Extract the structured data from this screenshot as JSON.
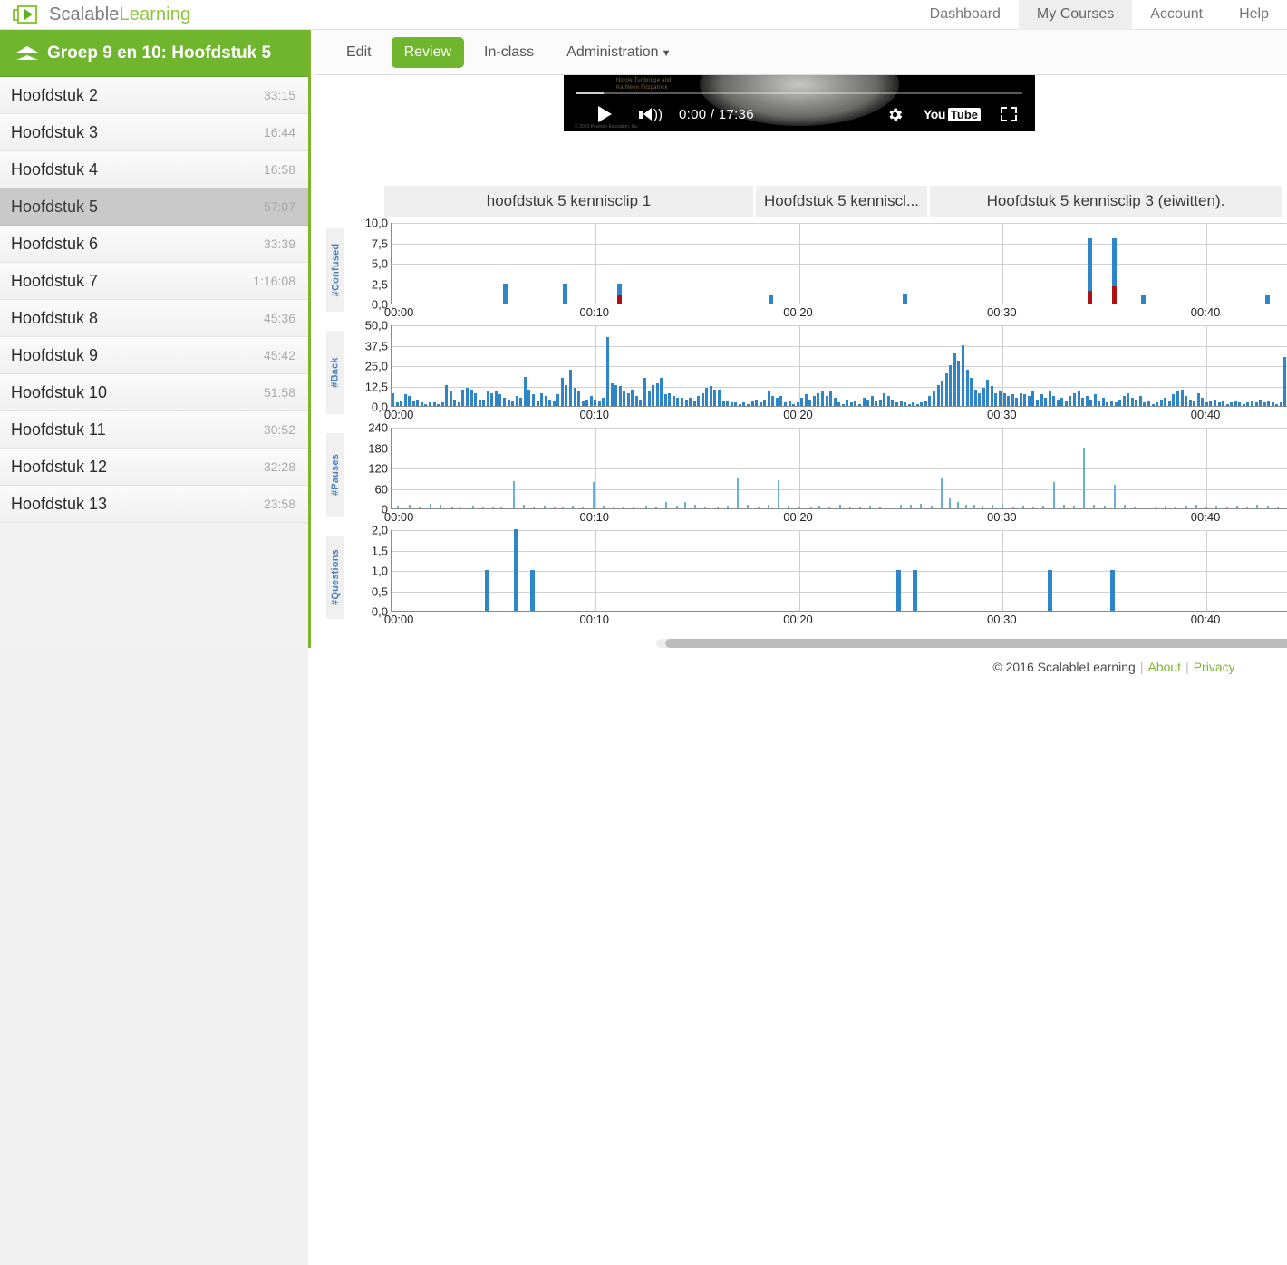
{
  "brand": {
    "name_part1": "Scalable",
    "name_part2": "Learning",
    "logo_icon": "speaker-play-icon",
    "green": "#8dc63f"
  },
  "topnav": {
    "items": [
      {
        "label": "Dashboard",
        "active": false
      },
      {
        "label": "My Courses",
        "active": true
      },
      {
        "label": "Account",
        "active": false
      },
      {
        "label": "Help",
        "active": false
      }
    ]
  },
  "sidebar": {
    "header": {
      "title": "Groep 9 en 10: Hoofdstuk 5",
      "icon": "chevron-up-icon"
    },
    "items": [
      {
        "label": "Hoofdstuk 2",
        "time": "33:15",
        "selected": false
      },
      {
        "label": "Hoofdstuk 3",
        "time": "16:44",
        "selected": false
      },
      {
        "label": "Hoofdstuk 4",
        "time": "16:58",
        "selected": false
      },
      {
        "label": "Hoofdstuk 5",
        "time": "57:07",
        "selected": true
      },
      {
        "label": "Hoofdstuk 6",
        "time": "33:39",
        "selected": false
      },
      {
        "label": "Hoofdstuk 7",
        "time": "1:16:08",
        "selected": false
      },
      {
        "label": "Hoofdstuk 8",
        "time": "45:36",
        "selected": false
      },
      {
        "label": "Hoofdstuk 9",
        "time": "45:42",
        "selected": false
      },
      {
        "label": "Hoofdstuk 10",
        "time": "51:58",
        "selected": false
      },
      {
        "label": "Hoofdstuk 11",
        "time": "30:52",
        "selected": false
      },
      {
        "label": "Hoofdstuk 12",
        "time": "32:28",
        "selected": false
      },
      {
        "label": "Hoofdstuk 13",
        "time": "23:58",
        "selected": false
      }
    ]
  },
  "subnav": {
    "tabs": [
      {
        "label": "Edit",
        "active": false,
        "dropdown": false
      },
      {
        "label": "Review",
        "active": true,
        "dropdown": false
      },
      {
        "label": "In-class",
        "active": false,
        "dropdown": false
      },
      {
        "label": "Administration",
        "active": false,
        "dropdown": true
      }
    ]
  },
  "video": {
    "time_display": "0:00 / 17:36",
    "current_time": "0:00",
    "duration": "17:36",
    "credit_line1": "Nicole Tunbridge and",
    "credit_line2": "Kathleen Fitzpatrick",
    "copyright": "© 2013 Pearson Education, Inc.",
    "play_icon": "play-icon",
    "volume_icon": "volume-icon",
    "settings_icon": "gear-icon",
    "youtube_icon": "youtube-logo-icon",
    "fullscreen_icon": "fullscreen-icon",
    "youtube_text1": "You",
    "youtube_text2": "Tube"
  },
  "clip_tabs": [
    {
      "label": "hoofdstuk 5 kennisclip 1",
      "active": false
    },
    {
      "label": "Hoofdstuk 5 kenniscl...",
      "active": false
    },
    {
      "label": "Hoofdstuk 5 kennisclip 3 (eiwitten).",
      "active": false
    }
  ],
  "footer": {
    "copyright": "© 2016 ScalableLearning",
    "about": "About",
    "privacy": "Privacy",
    "sep": "|"
  },
  "chart_data": [
    {
      "type": "bar",
      "title": "#Confused",
      "ylabel": "#Confused",
      "xlabel": "",
      "ylim": [
        0,
        10
      ],
      "yticks": [
        "0,0",
        "2,5",
        "5,0",
        "7,5",
        "10,0"
      ],
      "ytick_values": [
        0,
        2.5,
        5,
        7.5,
        10
      ],
      "xticks": [
        "00:00",
        "00:10",
        "00:20",
        "00:30",
        "00:40"
      ],
      "xtick_values": [
        0,
        10,
        20,
        30,
        40
      ],
      "xlim": [
        0,
        44
      ],
      "grid": true,
      "colors": {
        "primary": "#2e86c8",
        "secondary": "#b01116"
      },
      "series": [
        {
          "name": "confused",
          "color": "#2e86c8",
          "points": [
            [
              5.6,
              2.5
            ],
            [
              8.5,
              2.5
            ],
            [
              11.2,
              2.5
            ],
            [
              18.6,
              1.0
            ],
            [
              25.2,
              1.2
            ],
            [
              34.3,
              8.0
            ],
            [
              35.5,
              8.0
            ],
            [
              36.9,
              1.0
            ],
            [
              43.0,
              1.0
            ]
          ]
        },
        {
          "name": "confused-resolved",
          "color": "#b01116",
          "points": [
            [
              11.2,
              1.0
            ],
            [
              34.3,
              1.6
            ],
            [
              35.5,
              2.1
            ]
          ]
        }
      ]
    },
    {
      "type": "bar",
      "title": "#Back",
      "ylabel": "#Back",
      "xlabel": "",
      "ylim": [
        0,
        50
      ],
      "yticks": [
        "0,0",
        "12,5",
        "25,0",
        "37,5",
        "50,0"
      ],
      "ytick_values": [
        0,
        12.5,
        25,
        37.5,
        50
      ],
      "xticks": [
        "00:00",
        "00:10",
        "00:20",
        "00:30",
        "00:40"
      ],
      "xtick_values": [
        0,
        10,
        20,
        30,
        40
      ],
      "xlim": [
        0,
        44
      ],
      "grid": true,
      "colors": {
        "primary": "#2e86c8"
      },
      "bar_width_min": 0.22,
      "series": [
        {
          "name": "back",
          "color": "#2e86c8",
          "values": [
            8,
            2,
            3,
            7,
            6,
            3,
            4,
            2,
            1,
            2,
            2,
            1,
            2,
            13,
            9,
            4,
            2,
            10,
            11,
            10,
            8,
            4,
            4,
            9,
            8,
            9,
            7,
            5,
            4,
            3,
            6,
            5,
            18,
            10,
            7,
            3,
            8,
            6,
            4,
            3,
            7,
            17,
            13,
            22,
            11,
            9,
            3,
            4,
            6,
            4,
            3,
            5,
            42,
            14,
            13,
            12,
            9,
            8,
            10,
            6,
            4,
            17,
            9,
            13,
            14,
            17,
            7,
            8,
            6,
            5,
            5,
            4,
            5,
            3,
            6,
            8,
            11,
            12,
            10,
            10,
            3,
            3,
            2,
            2,
            1,
            2,
            1,
            3,
            4,
            2,
            4,
            9,
            6,
            5,
            6,
            2,
            3,
            1,
            2,
            5,
            7,
            4,
            6,
            8,
            9,
            6,
            9,
            5,
            2,
            1,
            4,
            2,
            3,
            1,
            5,
            4,
            6,
            3,
            4,
            8,
            6,
            4,
            2,
            3,
            2,
            1,
            2,
            1,
            2,
            3,
            6,
            9,
            13,
            15,
            20,
            25,
            32,
            28,
            37,
            22,
            17,
            10,
            8,
            11,
            16,
            12,
            8,
            9,
            8,
            6,
            7,
            5,
            8,
            7,
            6,
            9,
            4,
            7,
            5,
            9,
            6,
            4,
            5,
            3,
            6,
            8,
            9,
            5,
            6,
            4,
            7,
            3,
            5,
            2,
            3,
            2,
            4,
            6,
            8,
            5,
            4,
            6,
            2,
            3,
            1,
            2,
            4,
            5,
            3,
            7,
            9,
            10,
            6,
            4,
            3,
            8,
            5,
            2,
            3,
            4,
            2,
            3,
            1,
            2,
            3,
            2,
            1,
            2,
            3,
            2,
            4,
            2,
            3,
            2,
            1,
            2,
            30
          ]
        }
      ]
    },
    {
      "type": "bar",
      "title": "#Pauses",
      "ylabel": "#Pauses",
      "xlabel": "",
      "ylim": [
        0,
        240
      ],
      "yticks": [
        "0",
        "60",
        "120",
        "180",
        "240"
      ],
      "ytick_values": [
        0,
        60,
        120,
        180,
        240
      ],
      "xticks": [
        "00:00",
        "00:10",
        "00:20",
        "00:30",
        "00:40"
      ],
      "xtick_values": [
        0,
        10,
        20,
        30,
        40
      ],
      "xlim": [
        0,
        44
      ],
      "grid": true,
      "colors": {
        "primary": "#66b2dd"
      },
      "series": [
        {
          "name": "pauses",
          "color": "#66b2dd",
          "points": [
            [
              0.3,
              8
            ],
            [
              0.9,
              12
            ],
            [
              1.4,
              6
            ],
            [
              1.9,
              14
            ],
            [
              2.4,
              10
            ],
            [
              3.0,
              6
            ],
            [
              3.4,
              4
            ],
            [
              4.0,
              8
            ],
            [
              4.5,
              5
            ],
            [
              5.0,
              4
            ],
            [
              5.4,
              6
            ],
            [
              6.0,
              80
            ],
            [
              6.5,
              10
            ],
            [
              7.0,
              6
            ],
            [
              7.5,
              8
            ],
            [
              8.0,
              5
            ],
            [
              8.4,
              6
            ],
            [
              8.9,
              7
            ],
            [
              9.4,
              5
            ],
            [
              9.9,
              78
            ],
            [
              10.4,
              8
            ],
            [
              10.9,
              6
            ],
            [
              11.4,
              5
            ],
            [
              11.9,
              4
            ],
            [
              12.5,
              7
            ],
            [
              13.0,
              6
            ],
            [
              13.5,
              18
            ],
            [
              14.0,
              8
            ],
            [
              14.4,
              20
            ],
            [
              14.9,
              10
            ],
            [
              15.4,
              6
            ],
            [
              16.0,
              5
            ],
            [
              16.5,
              8
            ],
            [
              17.0,
              88
            ],
            [
              17.5,
              12
            ],
            [
              18.0,
              6
            ],
            [
              18.5,
              10
            ],
            [
              19.0,
              84
            ],
            [
              19.5,
              8
            ],
            [
              20.0,
              6
            ],
            [
              20.6,
              5
            ],
            [
              21.0,
              8
            ],
            [
              21.5,
              6
            ],
            [
              22.0,
              10
            ],
            [
              22.5,
              5
            ],
            [
              23.0,
              6
            ],
            [
              23.5,
              8
            ],
            [
              24.0,
              5
            ],
            [
              25.0,
              12
            ],
            [
              25.5,
              10
            ],
            [
              26.0,
              14
            ],
            [
              26.5,
              8
            ],
            [
              27.0,
              92
            ],
            [
              27.4,
              30
            ],
            [
              27.8,
              18
            ],
            [
              28.2,
              12
            ],
            [
              28.6,
              10
            ],
            [
              29.0,
              8
            ],
            [
              29.5,
              12
            ],
            [
              30.0,
              10
            ],
            [
              30.5,
              6
            ],
            [
              31.0,
              8
            ],
            [
              31.5,
              5
            ],
            [
              32.0,
              8
            ],
            [
              32.5,
              78
            ],
            [
              33.0,
              10
            ],
            [
              33.5,
              8
            ],
            [
              34.0,
              180
            ],
            [
              34.5,
              12
            ],
            [
              35.0,
              8
            ],
            [
              35.5,
              70
            ],
            [
              36.0,
              10
            ],
            [
              36.5,
              6
            ],
            [
              37.5,
              5
            ],
            [
              38.0,
              8
            ],
            [
              38.5,
              6
            ],
            [
              39.0,
              8
            ],
            [
              39.5,
              10
            ],
            [
              40.0,
              6
            ],
            [
              40.5,
              8
            ],
            [
              41.0,
              5
            ],
            [
              41.5,
              8
            ],
            [
              42.0,
              6
            ],
            [
              42.5,
              10
            ],
            [
              43.0,
              8
            ],
            [
              43.5,
              6
            ]
          ]
        }
      ]
    },
    {
      "type": "bar",
      "title": "#Questions",
      "ylabel": "#Questions",
      "xlabel": "",
      "ylim": [
        0,
        2
      ],
      "yticks": [
        "0,0",
        "0,5",
        "1,0",
        "1,5",
        "2,0"
      ],
      "ytick_values": [
        0,
        0.5,
        1,
        1.5,
        2
      ],
      "xticks": [
        "00:00",
        "00:10",
        "00:20",
        "00:30",
        "00:40"
      ],
      "xtick_values": [
        0,
        10,
        20,
        30,
        40
      ],
      "xlim": [
        0,
        44
      ],
      "grid": true,
      "colors": {
        "primary": "#2e86c8"
      },
      "series": [
        {
          "name": "questions",
          "color": "#2e86c8",
          "points": [
            [
              4.7,
              1.0
            ],
            [
              6.1,
              2.0
            ],
            [
              6.9,
              1.0
            ],
            [
              24.9,
              1.0
            ],
            [
              25.7,
              1.0
            ],
            [
              32.3,
              1.0
            ],
            [
              35.4,
              1.0
            ]
          ]
        }
      ]
    }
  ]
}
